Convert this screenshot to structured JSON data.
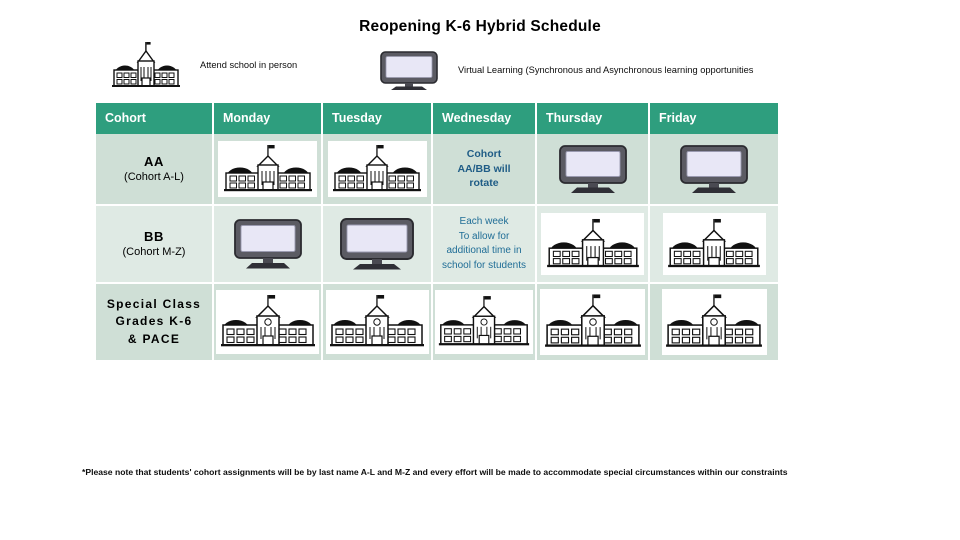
{
  "page": {
    "title": "Reopening K-6 Hybrid Schedule"
  },
  "legend": {
    "in_person": {
      "icon": "school-building-icon",
      "label": "Attend school in person"
    },
    "virtual": {
      "icon": "computer-monitor-icon",
      "label": "Virtual Learning (Synchronous and Asynchronous learning opportunities"
    }
  },
  "table": {
    "headers": [
      "Cohort",
      "Monday",
      "Tuesday",
      "Wednesday",
      "Thursday",
      "Friday"
    ],
    "rows": [
      {
        "id": "cohort-aa",
        "label_main": "AA",
        "label_sub": "(Cohort A-L)",
        "cells": [
          {
            "type": "icon",
            "icon": "school-building-icon"
          },
          {
            "type": "icon",
            "icon": "school-building-icon"
          },
          {
            "type": "note",
            "lines": [
              "Cohort",
              "AA/BB will",
              "rotate"
            ]
          },
          {
            "type": "icon",
            "icon": "computer-monitor-icon"
          },
          {
            "type": "icon",
            "icon": "computer-monitor-icon"
          }
        ]
      },
      {
        "id": "cohort-bb",
        "label_main": "BB",
        "label_sub": "(Cohort M-Z)",
        "cells": [
          {
            "type": "icon",
            "icon": "computer-monitor-icon"
          },
          {
            "type": "icon",
            "icon": "computer-monitor-icon"
          },
          {
            "type": "note",
            "lines": [
              "Each week",
              "To allow for",
              "additional time in",
              "school for students"
            ]
          },
          {
            "type": "icon",
            "icon": "school-building-icon"
          },
          {
            "type": "icon",
            "icon": "school-building-icon"
          }
        ]
      },
      {
        "id": "special-class",
        "label_lines": [
          "Special Class",
          "Grades K-6",
          "& PACE"
        ],
        "cells": [
          {
            "type": "icon",
            "icon": "school-building-icon"
          },
          {
            "type": "icon",
            "icon": "school-building-icon"
          },
          {
            "type": "icon",
            "icon": "school-building-icon"
          },
          {
            "type": "icon",
            "icon": "school-building-icon"
          },
          {
            "type": "icon",
            "icon": "school-building-icon"
          }
        ]
      }
    ]
  },
  "footnote": {
    "text": "*Please note that students' cohort assignments will be by last name A-L and M-Z and every effort will be made to accommodate special circumstances within our constraints"
  },
  "colors": {
    "header_bg": "#2e9e7e",
    "header_text": "#ffffff",
    "row_alt_a": "#cfdfd6",
    "row_alt_b": "#dfeae4",
    "note_text": "#1f5c86",
    "monitor_screen": "#e8e7f6",
    "monitor_bezel": "#5b5b63"
  }
}
